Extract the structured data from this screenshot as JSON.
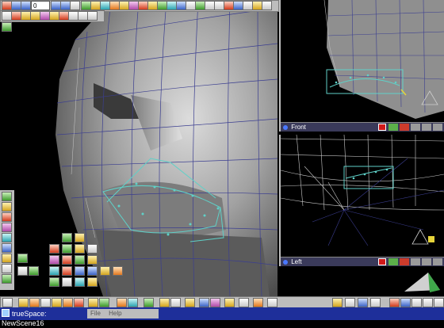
{
  "app": {
    "taskbar_title": "trueSpace: NewScene16",
    "frame_counter": "0",
    "menu_items": [
      "File",
      "Help"
    ]
  },
  "viewports": {
    "front": {
      "title": "Front"
    },
    "left": {
      "title": "Left"
    }
  },
  "colors": {
    "viewport_bg": "#000000",
    "mesh_gray": "#8f8f8f",
    "wire_blue": "#3b3e90",
    "selection_cyan": "#5fd1c8",
    "titlebar_navy": "#3a3a5a",
    "taskbar_blue": "#1e2f9a",
    "close_red": "#d01a1a"
  },
  "icons": {
    "top_toolbar": [
      "record-icon",
      "rewind-icon",
      "play-back-icon",
      "play-icon",
      "fast-forward-icon",
      "keyframe-icon",
      "object-tool-icon",
      "material-icon",
      "light-icon",
      "render-icon",
      "camera-icon",
      "paint-icon",
      "edit-icon",
      "move-icon",
      "rotate-icon",
      "scale-icon",
      "render-scene-icon",
      "eye-icon",
      "view-icon"
    ],
    "bottom_toolbar": [
      "object-icon",
      "sphere-icon",
      "primitive-icon",
      "material-icon",
      "texture-icon",
      "light-icon",
      "camera-icon",
      "shape-icon",
      "paint-icon",
      "deform-icon",
      "sweep-icon",
      "render-icon"
    ],
    "left_palette": [
      "cube-icon",
      "cylinder-icon",
      "sphere-icon",
      "cone-icon",
      "torus-icon",
      "plane-icon",
      "light-icon",
      "camera-icon",
      "text-icon",
      "spline-icon",
      "lathe-icon",
      "boolean-icon"
    ]
  }
}
